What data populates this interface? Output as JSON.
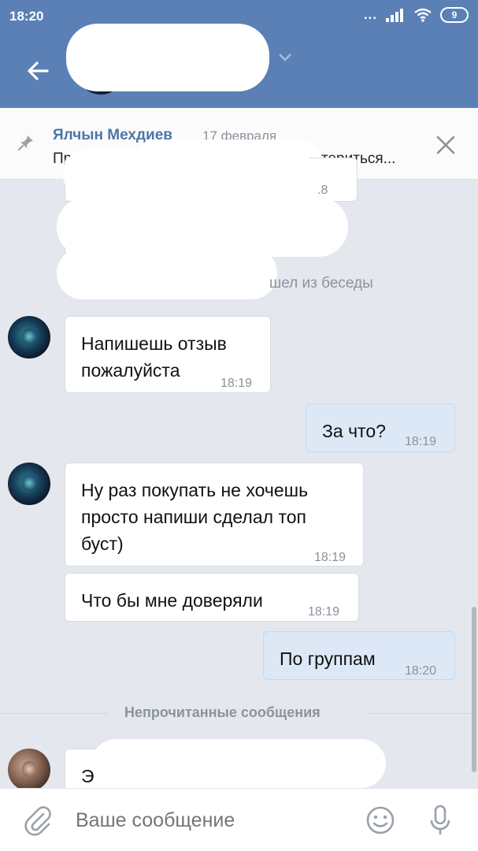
{
  "status_bar": {
    "time": "18:20",
    "indicators": "...",
    "battery": "9"
  },
  "header": {
    "title": "",
    "subtitle": "",
    "back_icon": "arrow-left-icon"
  },
  "pinned": {
    "author": "Ялчын Мехдиев",
    "date": "17 февраля",
    "text_start": "Правила Г",
    "text_end": "териться..."
  },
  "messages": [
    {
      "text": "",
      "time": ".8"
    },
    {
      "text": "",
      "time": "°"
    },
    {
      "text": "Напишешь отзыв\nпожалуйста",
      "time": "18:19"
    },
    {
      "text": "За что?",
      "time": "18:19"
    },
    {
      "text": "Ну раз покупать не хочешь\nпросто напиши сделал топ\nбуст)",
      "time": "18:19"
    },
    {
      "text": "Что бы мне доверяли",
      "time": "18:19"
    },
    {
      "text": "По группам",
      "time": "18:20"
    },
    {
      "text": "Э",
      "time": ""
    }
  ],
  "system_message": "шел из беседы",
  "unread_divider": "Непрочитанные сообщения",
  "composer": {
    "placeholder": "Ваше сообщение"
  },
  "colors": {
    "header": "#5a80b6",
    "background": "#e4e8ee",
    "outgoing_bubble": "#dde8f7",
    "link": "#4d75a6"
  }
}
